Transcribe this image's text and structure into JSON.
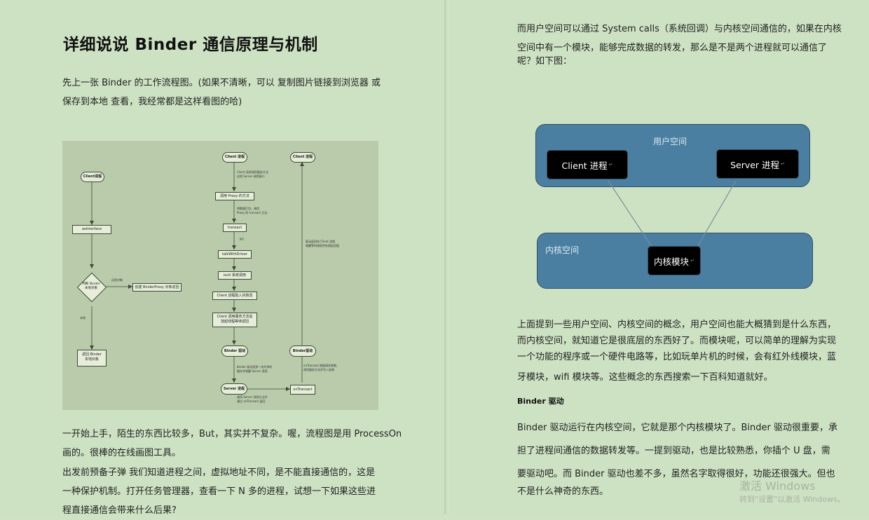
{
  "left": {
    "title": "详细说说 Binder 通信原理与机制",
    "intro": [
      "先上一张 Binder 的工作流程图。(如果不清晰，可以 复制图片链接到浏览器 或",
      "保存到本地 查看，我经常都是这样看图的哈)"
    ],
    "para2": [
      "一开始上手，陌生的东西比较多，But，其实并不复杂。喔，流程图是用 ProcessOn",
      "画的。很棒的在线画图工具。"
    ],
    "para3": [
      "出发前预备子弹 我们知道进程之间，虚拟地址不同，是不能直接通信的，这是",
      "一种保护机制。打开任务管理器，查看一下 N 多的进程，试想一下如果这些进",
      "程直接通信会带来什么后果?"
    ],
    "flowchart": {
      "client_process": "Client进程",
      "as_interface": "asInterface",
      "decision": [
        "判断 Binder",
        "本地对象"
      ],
      "label_remote": "远程对象",
      "label_local": "本地",
      "create_proxy": "创建 BinderProxy 对象返回",
      "return_local": [
        "返回 Binder",
        "本地对象"
      ],
      "client_process_2": "Client 进程",
      "note_call": [
        "Client 进程调用服务方法",
        "远程 Server 调用接口"
      ],
      "proxy_method": "调用 Proxy 的方法",
      "note_pack": [
        "将数据打包，调用",
        "Proxy 的 transact 方法"
      ],
      "transact": "transact",
      "label_ipc": "IPC",
      "talk_with_driver": "talkWithDriver",
      "ioctl": "ioctl 系统调用",
      "client_suspend": "Client 进程陷入内核态",
      "client_wait": [
        "Client 调用服务方法后",
        "挂起线程等待返回"
      ],
      "binder_driver_1": "Binder 驱动",
      "note_driver": [
        "Binder 驱动找到一块共享的",
        "缓存并唤醒 Server 进程"
      ],
      "server_process": "Server 进程",
      "on_transact": "onTransact",
      "note_server": [
        "调用 Server 进程方法并",
        "通过 onTransact 返回"
      ],
      "client_process_3": "Client 进程",
      "note_return": [
        "驱动返回给 Client 进程",
        "唤醒等待线程并处理返回值"
      ],
      "binder_driver_2": "Binder驱动",
      "note_ontransact": [
        "onTransact 根据请求参数，",
        "调用服务方法并写入结果"
      ]
    }
  },
  "right": {
    "para1": [
      "而用户空间可以通过 System calls（系统回调）与内核空间通信的，如果在内核",
      "空间中有一个模块，能够完成数据的转发，那么是不是两个进程就可以通信了",
      "呢？如下图："
    ],
    "diagram": {
      "user_space": "用户空间",
      "client": "Client 进程",
      "server": "Server 进程",
      "kernel_space": "内核空间",
      "kernel_module": "内核模块"
    },
    "para2": [
      "上面提到一些用户空间、内核空间的概念，用户空间也能大概猜到是什么东西，",
      "而内核空间，就知道它是很底层的东西好了。而模块呢，可以简单的理解为实现",
      "一个功能的程序或一个硬件电路等，比如玩单片机的时候，会有红外线模块，蓝",
      "牙模块，wifi 模块等。这些概念的东西搜索一下百科知道就好。"
    ],
    "heading": "Binder 驱动",
    "para3": [
      "Binder 驱动运行在内核空间，它就是那个内核模块了。Binder 驱动很重要，承",
      "担了进程间通信的数据转发等。一提到驱动，也是比较熟悉，你插个 U 盘，需",
      "要驱动吧。而 Binder 驱动也差不多，虽然名字取得很好，功能还很强大。但也",
      "不是什么神奇的东西。"
    ]
  },
  "watermark": {
    "line1": "激活 Windows",
    "line2": "转到\"设置\"以激活 Windows。"
  }
}
